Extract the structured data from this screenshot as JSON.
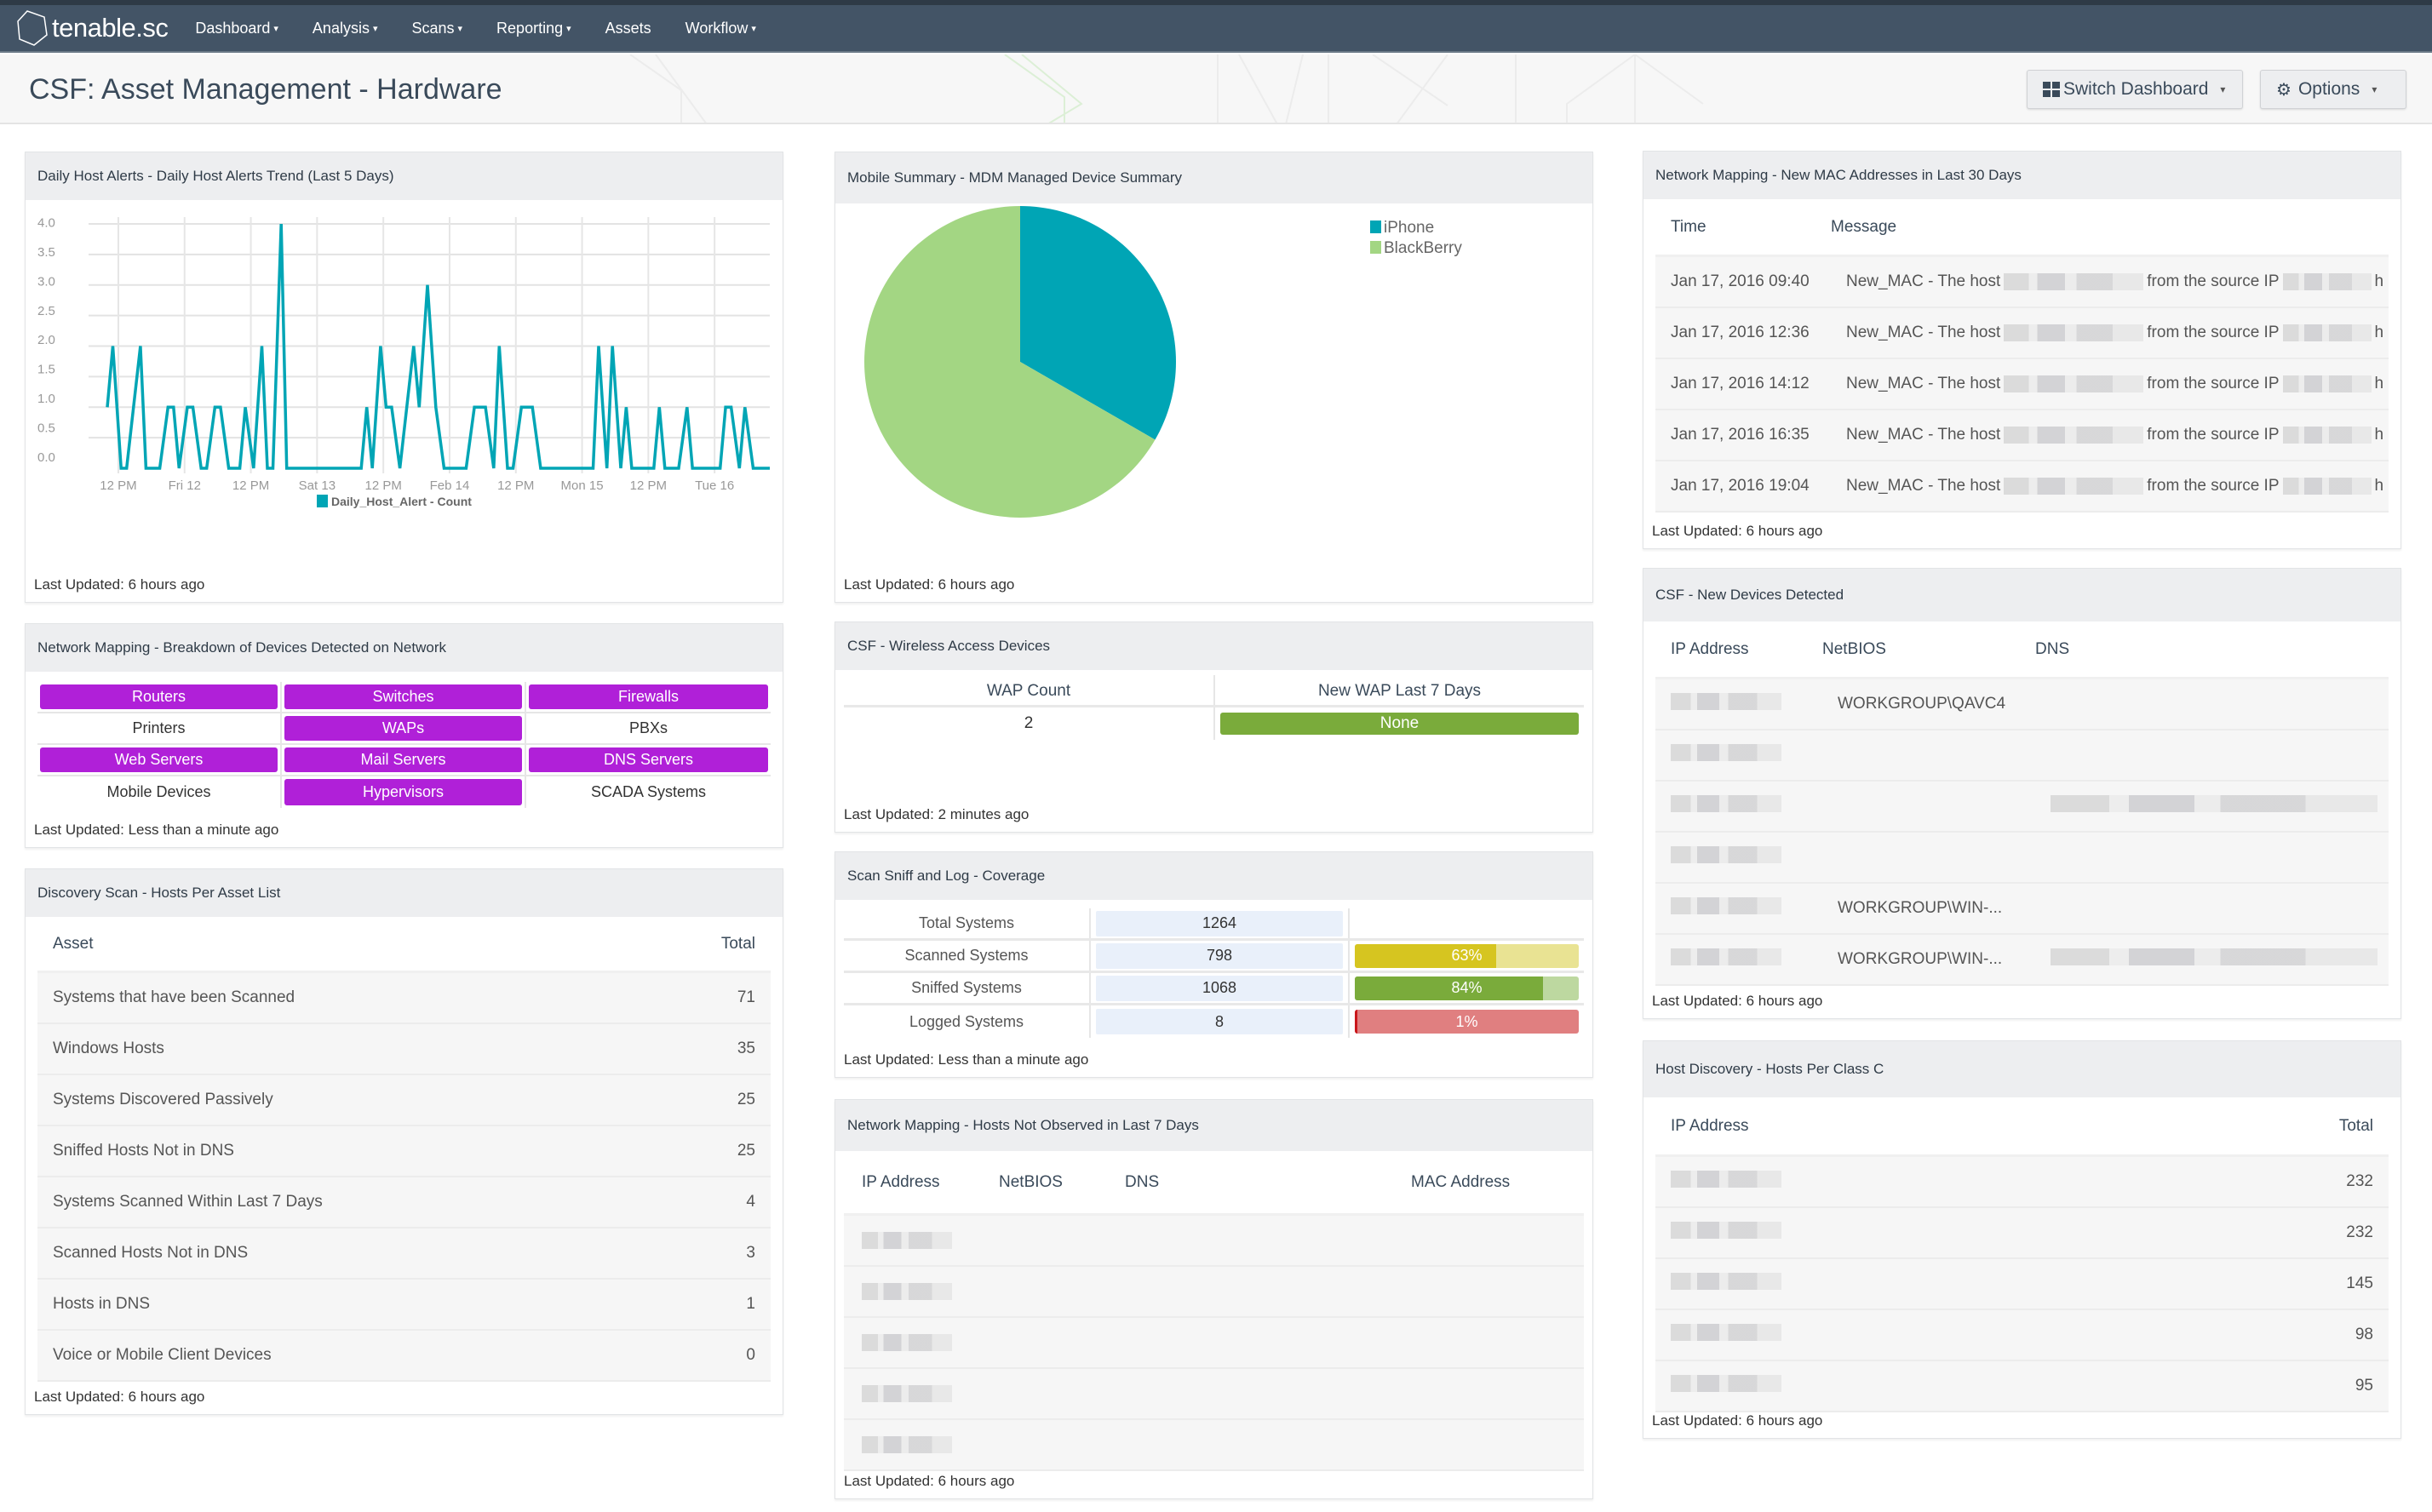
{
  "app": {
    "logo_text": "tenable.sc",
    "nav": [
      {
        "label": "Dashboard",
        "has_caret": true
      },
      {
        "label": "Analysis",
        "has_caret": true
      },
      {
        "label": "Scans",
        "has_caret": true
      },
      {
        "label": "Reporting",
        "has_caret": true
      },
      {
        "label": "Assets",
        "has_caret": false
      },
      {
        "label": "Workflow",
        "has_caret": true
      }
    ],
    "caret_glyph": "▾"
  },
  "header": {
    "title": "CSF: Asset Management - Hardware",
    "switch_dashboard_label": "Switch Dashboard",
    "options_label": "Options",
    "gear_glyph": "⚙"
  },
  "colors": {
    "navbar": "#435466",
    "accent_teal": "#00a5b5",
    "pie_green": "#a3d683",
    "device_detected": "#b020d8",
    "ok_green": "#7aab3b",
    "warn_yellow": "#d6c520",
    "crit_red": "#e07f80"
  },
  "panels": {
    "daily_alerts": {
      "title": "Daily Host Alerts - Daily Host Alerts Trend (Last 5 Days)",
      "legend": "Daily_Host_Alert - Count",
      "last_updated": "Last Updated: 6 hours ago"
    },
    "device_breakdown": {
      "title": "Network Mapping - Breakdown of Devices Detected on Network",
      "items": [
        {
          "label": "Routers",
          "detected": true
        },
        {
          "label": "Switches",
          "detected": true
        },
        {
          "label": "Firewalls",
          "detected": true
        },
        {
          "label": "Printers",
          "detected": false
        },
        {
          "label": "WAPs",
          "detected": true
        },
        {
          "label": "PBXs",
          "detected": false
        },
        {
          "label": "Web Servers",
          "detected": true
        },
        {
          "label": "Mail Servers",
          "detected": true
        },
        {
          "label": "DNS Servers",
          "detected": true
        },
        {
          "label": "Mobile Devices",
          "detected": false
        },
        {
          "label": "Hypervisors",
          "detected": true
        },
        {
          "label": "SCADA Systems",
          "detected": false
        }
      ],
      "last_updated": "Last Updated: Less than a minute ago"
    },
    "discovery_scan": {
      "title": "Discovery Scan - Hosts Per Asset List",
      "columns": [
        "Asset",
        "Total"
      ],
      "rows": [
        {
          "asset": "Systems that have been Scanned",
          "total": "71"
        },
        {
          "asset": "Windows Hosts",
          "total": "35"
        },
        {
          "asset": "Systems Discovered Passively",
          "total": "25"
        },
        {
          "asset": "Sniffed Hosts Not in DNS",
          "total": "25"
        },
        {
          "asset": "Systems Scanned Within Last 7 Days",
          "total": "4"
        },
        {
          "asset": "Scanned Hosts Not in DNS",
          "total": "3"
        },
        {
          "asset": "Hosts in DNS",
          "total": "1"
        },
        {
          "asset": "Voice or Mobile Client Devices",
          "total": "0"
        }
      ],
      "last_updated": "Last Updated: 6 hours ago"
    },
    "mobile_summary": {
      "title": "Mobile Summary - MDM Managed Device Summary",
      "last_updated": "Last Updated: 6 hours ago"
    },
    "wireless": {
      "title": "CSF - Wireless Access Devices",
      "columns": [
        "WAP Count",
        "New WAP Last 7 Days"
      ],
      "wap_count": "2",
      "new_wap": "None",
      "last_updated": "Last Updated: 2 minutes ago"
    },
    "coverage": {
      "title": "Scan Sniff and Log - Coverage",
      "rows": [
        {
          "label": "Total Systems",
          "value": "1264",
          "percent": null,
          "percent_label": ""
        },
        {
          "label": "Scanned Systems",
          "value": "798",
          "percent": 63,
          "percent_label": "63%",
          "fill": "#d6c520",
          "track": "#e9e393"
        },
        {
          "label": "Sniffed Systems",
          "value": "1068",
          "percent": 84,
          "percent_label": "84%",
          "fill": "#7aab3b",
          "track": "#bdd8a0"
        },
        {
          "label": "Logged Systems",
          "value": "8",
          "percent": 1,
          "percent_label": "1%",
          "fill": "#c9161b",
          "track": "#e07f80"
        }
      ],
      "last_updated": "Last Updated: Less than a minute ago"
    },
    "not_observed": {
      "title": "Network Mapping - Hosts Not Observed in Last 7 Days",
      "columns": [
        "IP Address",
        "NetBIOS",
        "DNS",
        "MAC Address"
      ],
      "rows": [
        {
          "ip": "[redacted]",
          "netbios": "",
          "dns": "",
          "mac": ""
        },
        {
          "ip": "[redacted]",
          "netbios": "",
          "dns": "",
          "mac": ""
        },
        {
          "ip": "[redacted]",
          "netbios": "",
          "dns": "",
          "mac": ""
        },
        {
          "ip": "[redacted]",
          "netbios": "",
          "dns": "",
          "mac": ""
        },
        {
          "ip": "[redacted]",
          "netbios": "",
          "dns": "",
          "mac": ""
        }
      ],
      "last_updated": "Last Updated: 6 hours ago"
    },
    "new_mac": {
      "title": "Network Mapping - New MAC Addresses in Last 30 Days",
      "columns": [
        "Time",
        "Message"
      ],
      "rows": [
        {
          "time": "Jan 17, 2016 09:40",
          "msg_prefix": "New_MAC - The host",
          "msg_middle": "from the source IP",
          "msg_suffix": "h"
        },
        {
          "time": "Jan 17, 2016 12:36",
          "msg_prefix": "New_MAC - The host",
          "msg_middle": "from the source IP",
          "msg_suffix": "h"
        },
        {
          "time": "Jan 17, 2016 14:12",
          "msg_prefix": "New_MAC - The host",
          "msg_middle": "from the source IP",
          "msg_suffix": "h"
        },
        {
          "time": "Jan 17, 2016 16:35",
          "msg_prefix": "New_MAC - The host",
          "msg_middle": "from the source IP",
          "msg_suffix": "h"
        },
        {
          "time": "Jan 17, 2016 19:04",
          "msg_prefix": "New_MAC - The host",
          "msg_middle": "from the source IP",
          "msg_suffix": "h"
        }
      ],
      "last_updated": "Last Updated: 6 hours ago"
    },
    "new_devices": {
      "title": "CSF - New Devices Detected",
      "columns": [
        "IP Address",
        "NetBIOS",
        "DNS"
      ],
      "rows": [
        {
          "ip": "[redacted]",
          "netbios": "WORKGROUP\\QAVC4",
          "dns": ""
        },
        {
          "ip": "[redacted]",
          "netbios": "",
          "dns": ""
        },
        {
          "ip": "[redacted]",
          "netbios": "",
          "dns": "[redacted]"
        },
        {
          "ip": "[redacted]",
          "netbios": "",
          "dns": ""
        },
        {
          "ip": "[redacted]",
          "netbios": "WORKGROUP\\WIN-...",
          "dns": ""
        },
        {
          "ip": "[redacted]",
          "netbios": "WORKGROUP\\WIN-...",
          "dns": "[redacted]"
        }
      ],
      "last_updated": "Last Updated: 6 hours ago"
    },
    "class_c": {
      "title": "Host Discovery - Hosts Per Class C",
      "columns": [
        "IP Address",
        "Total"
      ],
      "rows": [
        {
          "ip": "[redacted]",
          "total": "232"
        },
        {
          "ip": "[redacted]",
          "total": "232"
        },
        {
          "ip": "[redacted]",
          "total": "145"
        },
        {
          "ip": "[redacted]",
          "total": "98"
        },
        {
          "ip": "[redacted]",
          "total": "95"
        }
      ],
      "last_updated": "Last Updated: 6 hours ago"
    }
  },
  "chart_data": [
    {
      "type": "line",
      "title": "Daily Host Alerts - Daily Host Alerts Trend (Last 5 Days)",
      "xlabel": "",
      "ylabel": "",
      "x_unit": "hours from start of range",
      "xlim": [
        0,
        120
      ],
      "ylim": [
        0,
        4
      ],
      "grid": true,
      "legend": "bottom-center",
      "y_tick_labels": [
        "0.0",
        "0.5",
        "1.0",
        "1.5",
        "2.0",
        "2.5",
        "3.0",
        "3.5",
        "4.0"
      ],
      "x_ticks": [
        {
          "x": 2,
          "label": "12 PM"
        },
        {
          "x": 14,
          "label": "Fri 12"
        },
        {
          "x": 26,
          "label": "12 PM"
        },
        {
          "x": 38,
          "label": "Sat 13"
        },
        {
          "x": 50,
          "label": "12 PM"
        },
        {
          "x": 62,
          "label": "Feb 14"
        },
        {
          "x": 74,
          "label": "12 PM"
        },
        {
          "x": 86,
          "label": "Mon 15"
        },
        {
          "x": 98,
          "label": "12 PM"
        },
        {
          "x": 110,
          "label": "Tue 16"
        }
      ],
      "series": [
        {
          "name": "Daily_Host_Alert - Count",
          "color": "#00a5b5",
          "points": [
            [
              0,
              1
            ],
            [
              1,
              2
            ],
            [
              2.5,
              0
            ],
            [
              3.5,
              0
            ],
            [
              6,
              2
            ],
            [
              7,
              0
            ],
            [
              9.5,
              0
            ],
            [
              11,
              1
            ],
            [
              12,
              1
            ],
            [
              13,
              0
            ],
            [
              14.5,
              1
            ],
            [
              15.5,
              1
            ],
            [
              17,
              0
            ],
            [
              18,
              0
            ],
            [
              19.5,
              1
            ],
            [
              20.5,
              1
            ],
            [
              22,
              0
            ],
            [
              24,
              0
            ],
            [
              25,
              1
            ],
            [
              26.5,
              0
            ],
            [
              28,
              2
            ],
            [
              29,
              0
            ],
            [
              30,
              0
            ],
            [
              31.5,
              4
            ],
            [
              32.5,
              0
            ],
            [
              46,
              0
            ],
            [
              47,
              1
            ],
            [
              48,
              0
            ],
            [
              49.5,
              2
            ],
            [
              50.5,
              1
            ],
            [
              51.5,
              1
            ],
            [
              53,
              0
            ],
            [
              55.5,
              2
            ],
            [
              56.5,
              1
            ],
            [
              58,
              3
            ],
            [
              59.5,
              1
            ],
            [
              61,
              0
            ],
            [
              65,
              0
            ],
            [
              66.5,
              1
            ],
            [
              68.5,
              1
            ],
            [
              70,
              0
            ],
            [
              71,
              2
            ],
            [
              72.5,
              0
            ],
            [
              73.5,
              0
            ],
            [
              75,
              1
            ],
            [
              77,
              1
            ],
            [
              78.5,
              0
            ],
            [
              88,
              0
            ],
            [
              89,
              2
            ],
            [
              90.5,
              0
            ],
            [
              91.5,
              2
            ],
            [
              93,
              0
            ],
            [
              94,
              1
            ],
            [
              95,
              0
            ],
            [
              99,
              0
            ],
            [
              100,
              1
            ],
            [
              101,
              0
            ],
            [
              103.5,
              0
            ],
            [
              105,
              1
            ],
            [
              106,
              0
            ],
            [
              111,
              0
            ],
            [
              112,
              1
            ],
            [
              113,
              1
            ],
            [
              114.5,
              0
            ],
            [
              115.5,
              1
            ],
            [
              117,
              0
            ],
            [
              120,
              0
            ]
          ]
        }
      ]
    },
    {
      "type": "pie",
      "title": "Mobile Summary - MDM Managed Device Summary",
      "legend": "top-right",
      "slices": [
        {
          "label": "iPhone",
          "value": 1,
          "color": "#00a5b5"
        },
        {
          "label": "BlackBerry",
          "value": 2,
          "color": "#a3d683"
        }
      ]
    }
  ]
}
